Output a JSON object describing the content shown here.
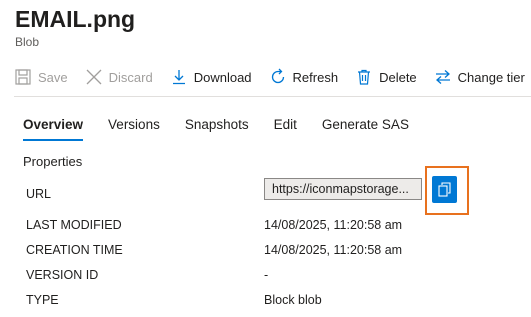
{
  "header": {
    "title": "EMAIL.png",
    "subtitle": "Blob"
  },
  "toolbar": {
    "save": {
      "label": "Save",
      "icon": "save-icon"
    },
    "discard": {
      "label": "Discard",
      "icon": "close-icon"
    },
    "download": {
      "label": "Download",
      "icon": "download-icon"
    },
    "refresh": {
      "label": "Refresh",
      "icon": "refresh-icon"
    },
    "delete": {
      "label": "Delete",
      "icon": "trash-icon"
    },
    "change_tier": {
      "label": "Change tier",
      "icon": "swap-arrows-icon"
    }
  },
  "tabs": [
    "Overview",
    "Versions",
    "Snapshots",
    "Edit",
    "Generate SAS"
  ],
  "active_tab": "Overview",
  "properties": {
    "heading": "Properties",
    "url_label": "URL",
    "url_value": "https://iconmapstorage...",
    "last_modified_label": "LAST MODIFIED",
    "last_modified_value": "14/08/2025, 11:20:58 am",
    "creation_time_label": "CREATION TIME",
    "creation_time_value": "14/08/2025, 11:20:58 am",
    "version_id_label": "VERSION ID",
    "version_id_value": "-",
    "type_label": "TYPE",
    "type_value": "Block blob"
  },
  "colors": {
    "accent": "#0078d4",
    "highlight": "#e8711e",
    "disabled": "#a19f9d"
  }
}
